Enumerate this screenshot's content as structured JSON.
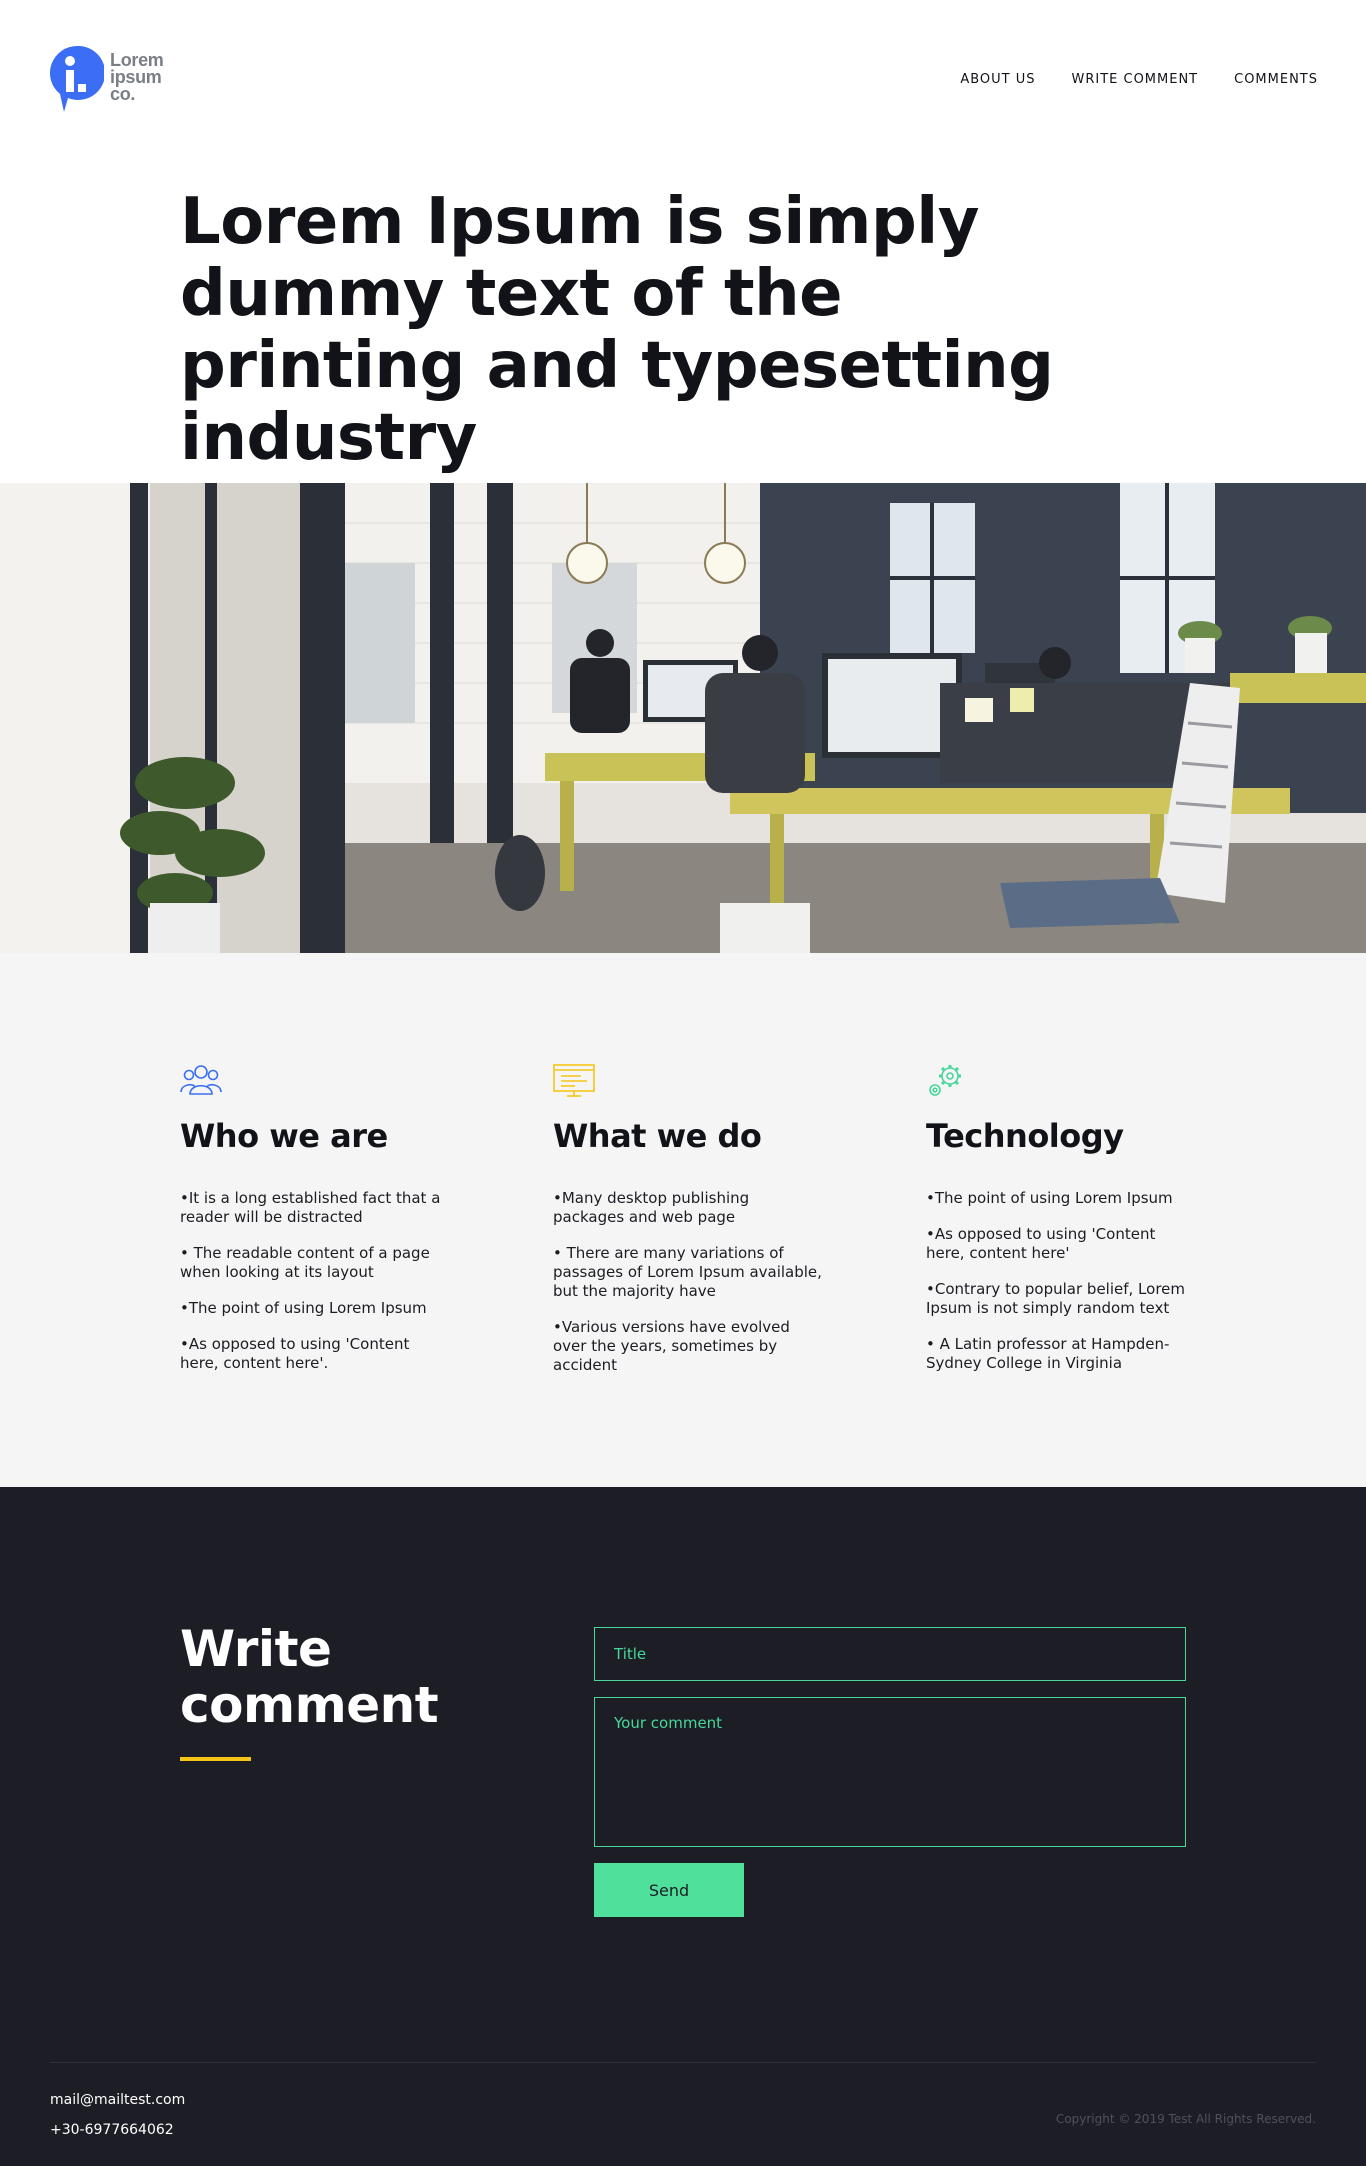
{
  "brand": {
    "name_line1": "Lorem",
    "name_line2": "ipsum",
    "name_line3": "co.",
    "accent_color": "#3b6ef5"
  },
  "nav": {
    "items": [
      {
        "label": "ABOUT US"
      },
      {
        "label": "WRITE COMMENT"
      },
      {
        "label": "COMMENTS"
      }
    ]
  },
  "hero": {
    "title": "Lorem Ipsum is simply dummy text of the printing and typesetting industry"
  },
  "features": [
    {
      "icon": "people-icon",
      "icon_color": "#3b6ef5",
      "heading": "Who we are",
      "items": [
        "It is a long established fact that a reader will be distracted",
        " The readable content of a page when looking at its layout",
        "The point of using Lorem Ipsum",
        "As opposed to using 'Content here, content here'."
      ]
    },
    {
      "icon": "monitor-icon",
      "icon_color": "#f5c518",
      "heading": "What we do",
      "items": [
        "Many desktop publishing packages and web page",
        " There are many variations of passages of Lorem Ipsum available, but the majority have",
        "Various versions have evolved over the years, sometimes by accident"
      ]
    },
    {
      "icon": "gears-icon",
      "icon_color": "#47d79a",
      "heading": "Technology",
      "items": [
        "The point of using Lorem Ipsum",
        "As opposed to using 'Content here, content here'",
        "Contrary to popular belief, Lorem Ipsum is not simply random text",
        " A Latin professor at Hampden-Sydney College in Virginia"
      ]
    }
  ],
  "comment_form": {
    "heading": "Write comment",
    "title_placeholder": "Title",
    "comment_placeholder": "Your comment",
    "send_label": "Send",
    "accent_color": "#47d79a",
    "underline_color": "#f5c518"
  },
  "footer": {
    "email": "mail@mailtest.com",
    "phone": "+30-6977664062",
    "copyright": "Copyright © 2019 Test All Rights Reserved."
  }
}
